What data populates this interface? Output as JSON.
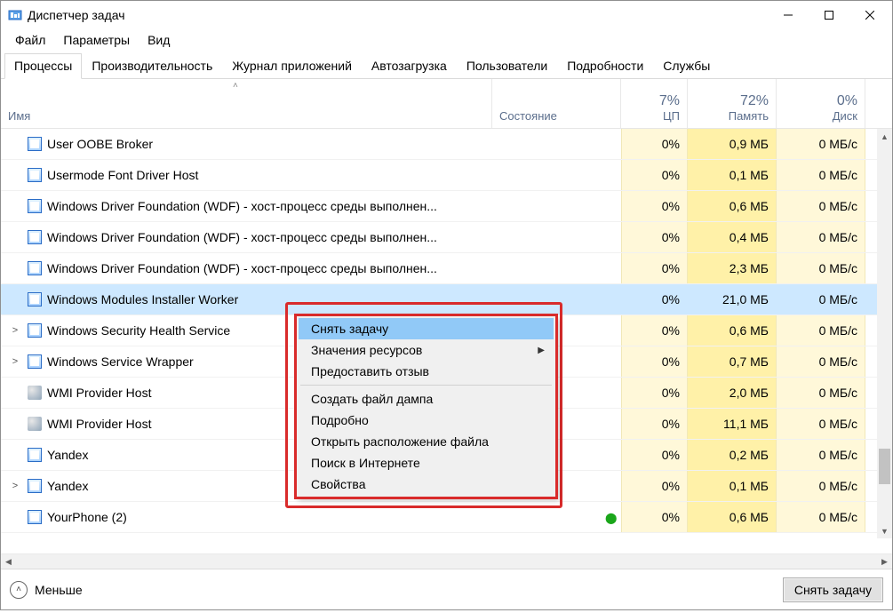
{
  "window": {
    "title": "Диспетчер задач"
  },
  "menubar": {
    "file": "Файл",
    "options": "Параметры",
    "view": "Вид"
  },
  "tabs": {
    "processes": "Процессы",
    "performance": "Производительность",
    "app_history": "Журнал приложений",
    "startup": "Автозагрузка",
    "users": "Пользователи",
    "details": "Подробности",
    "services": "Службы",
    "active": "processes"
  },
  "columns": {
    "name": "Имя",
    "status": "Состояние",
    "cpu": {
      "pct": "7%",
      "label": "ЦП"
    },
    "mem": {
      "pct": "72%",
      "label": "Память"
    },
    "disk": {
      "pct": "0%",
      "label": "Диск"
    }
  },
  "rows": [
    {
      "expand": "",
      "icon": "app",
      "name": "User OOBE Broker",
      "cpu": "0%",
      "mem": "0,9 МБ",
      "disk": "0 МБ/с"
    },
    {
      "expand": "",
      "icon": "app",
      "name": "Usermode Font Driver Host",
      "cpu": "0%",
      "mem": "0,1 МБ",
      "disk": "0 МБ/с"
    },
    {
      "expand": "",
      "icon": "app",
      "name": "Windows Driver Foundation (WDF) - хост-процесс среды выполнен...",
      "cpu": "0%",
      "mem": "0,6 МБ",
      "disk": "0 МБ/с"
    },
    {
      "expand": "",
      "icon": "app",
      "name": "Windows Driver Foundation (WDF) - хост-процесс среды выполнен...",
      "cpu": "0%",
      "mem": "0,4 МБ",
      "disk": "0 МБ/с"
    },
    {
      "expand": "",
      "icon": "app",
      "name": "Windows Driver Foundation (WDF) - хост-процесс среды выполнен...",
      "cpu": "0%",
      "mem": "2,3 МБ",
      "disk": "0 МБ/с"
    },
    {
      "expand": "",
      "icon": "app",
      "name": "Windows Modules Installer Worker",
      "cpu": "0%",
      "mem": "21,0 МБ",
      "disk": "0 МБ/с",
      "selected": true
    },
    {
      "expand": ">",
      "icon": "app",
      "name": "Windows Security Health Service",
      "cpu": "0%",
      "mem": "0,6 МБ",
      "disk": "0 МБ/с"
    },
    {
      "expand": ">",
      "icon": "app",
      "name": "Windows Service Wrapper",
      "cpu": "0%",
      "mem": "0,7 МБ",
      "disk": "0 МБ/с"
    },
    {
      "expand": "",
      "icon": "svc",
      "name": "WMI Provider Host",
      "cpu": "0%",
      "mem": "2,0 МБ",
      "disk": "0 МБ/с"
    },
    {
      "expand": "",
      "icon": "svc",
      "name": "WMI Provider Host",
      "cpu": "0%",
      "mem": "11,1 МБ",
      "disk": "0 МБ/с"
    },
    {
      "expand": "",
      "icon": "app",
      "name": "Yandex",
      "cpu": "0%",
      "mem": "0,2 МБ",
      "disk": "0 МБ/с"
    },
    {
      "expand": ">",
      "icon": "app",
      "name": "Yandex",
      "cpu": "0%",
      "mem": "0,1 МБ",
      "disk": "0 МБ/с"
    },
    {
      "expand": "",
      "icon": "app",
      "name": "YourPhone (2)",
      "cpu": "0%",
      "mem": "0,6 МБ",
      "disk": "0 МБ/с",
      "leaf": true
    }
  ],
  "context_menu": {
    "end_task": "Снять задачу",
    "resource_values": "Значения ресурсов",
    "feedback": "Предоставить отзыв",
    "create_dump": "Создать файл дампа",
    "details": "Подробно",
    "open_location": "Открыть расположение файла",
    "search_online": "Поиск в Интернете",
    "properties": "Свойства"
  },
  "footer": {
    "fewer": "Меньше",
    "end_task": "Снять задачу"
  }
}
